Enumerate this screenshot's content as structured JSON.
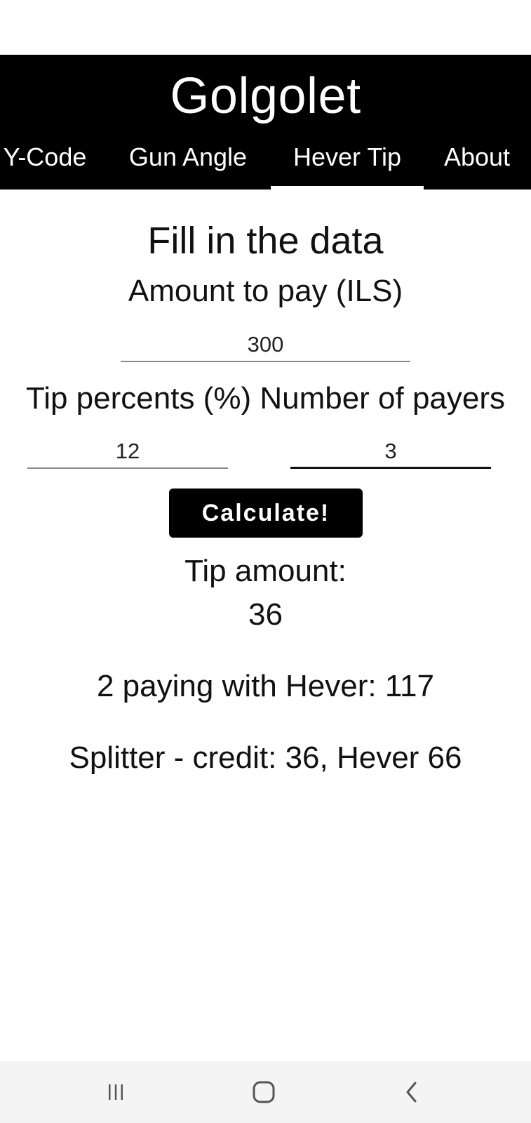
{
  "app": {
    "title": "Golgolet"
  },
  "tabs": [
    {
      "label": "Y-Code"
    },
    {
      "label": "Gun Angle"
    },
    {
      "label": "Hever Tip",
      "selected": true
    },
    {
      "label": "About"
    }
  ],
  "form": {
    "heading": "Fill in the data",
    "amount_label": "Amount to pay (ILS)",
    "amount_value": "300",
    "tip_payers_label": "Tip percents (%) Number of payers",
    "tip_value": "12",
    "payers_value": "3",
    "calculate_label": "Calculate!"
  },
  "results": {
    "tip_amount_label": "Tip amount:",
    "tip_amount_value": "36",
    "hever_line": "2 paying with Hever: 117",
    "splitter_line": "Splitter - credit: 36, Hever 66"
  },
  "nav": {
    "recent_icon": "recent-apps-icon",
    "home_icon": "home-icon",
    "back_icon": "back-icon"
  },
  "colors": {
    "header_bg": "#000000",
    "header_text": "#ffffff",
    "button_bg": "#000000"
  }
}
